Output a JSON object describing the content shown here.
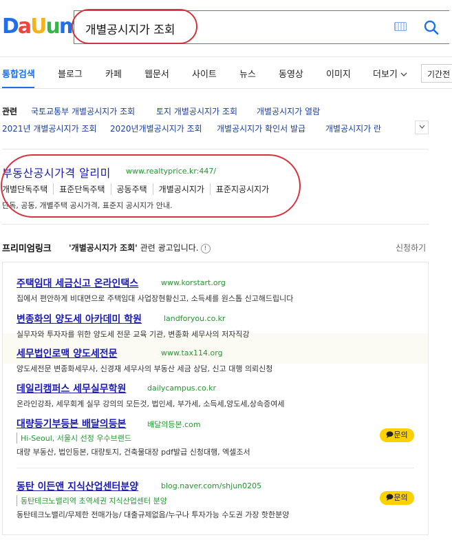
{
  "logo": {
    "letters": [
      "D",
      "a",
      "U",
      "u",
      "m"
    ]
  },
  "search": {
    "query": "개별공시지가 조회"
  },
  "tabs": [
    "통합검색",
    "블로그",
    "카페",
    "웹문서",
    "사이트",
    "뉴스",
    "동영상",
    "이미지",
    "더보기"
  ],
  "period_label": "기간전",
  "related": {
    "heading": "관련",
    "row1": [
      "국토교통부 개별공시지가 조회",
      "토지 개별공시지가 조회",
      "개별공시지가 열람"
    ],
    "row2": [
      "2021년 개별공시지가 조회",
      "2020년개별공시지가 조회",
      "개별공시지가 확인서 발급",
      "개별공시지가 란"
    ]
  },
  "site": {
    "title": "부동산공시가격 알리미",
    "url": "www.realtyprice.kr:447/",
    "links": [
      "개별단독주택",
      "표준단독주택",
      "공동주택",
      "개별공시지가",
      "표준지공시지가"
    ],
    "desc": "단독, 공동, 개별주택 공시가격, 표준지 공시지가 안내."
  },
  "premium": {
    "heading": "프리미엄링크",
    "query": "'개별공시지가 조회'",
    "suffix": "관련 광고입니다.",
    "info_icon": "!",
    "apply": "신청하기"
  },
  "ads": [
    {
      "title": "주택임대 세금신고 온라인택스",
      "url": "www.korstart.org",
      "desc": "집에서 편안하게 비대면으로 주택임대 사업장현황신고, 소득세를 원스톱 신고해드립니다"
    },
    {
      "title": "변종화의 양도세 아카데미 학원",
      "url": "landforyou.co.kr",
      "desc": "실무자와 투자자를 위한 양도세 전문 교육 기관, 변종화 세무사의 저자직강"
    },
    {
      "title": "세무법인로맥 양도세전문",
      "url": "www.tax114.org",
      "desc": "양도세전문 변종화세무사, 신경재 세무사의 부동산 세금 상담, 신고 대행 의뢰신청"
    },
    {
      "title": "데일리캠퍼스 세무실무학원",
      "url": "dailycampus.co.kr",
      "desc": "온라인강좌, 세무회계 실무 강의의 모든것, 법인세, 부가세, 소득세,양도세,상속증여세"
    },
    {
      "title": "대량등기부등본 배달의등본",
      "url": "배달의등본.com",
      "sub": "Hi-Seoul, 서울시 선정 우수브랜드",
      "desc": "대량 부동산, 법인등본, 대량토지, 건축물대장 pdf발급 신청대행, 엑셀조서",
      "inquiry": "문의"
    },
    {
      "title": "동탄 이든앤 지식산업센터분양",
      "url": "blog.naver.com/shjun0205",
      "sub": "동탄테크노밸리역 초역세권 지식산업센터 분양",
      "desc": "동탄테크노밸리/무제한 전매가능/ 대출규제없음/누구나 투자가능 수도권 가장 핫한분양",
      "inquiry": "문의"
    }
  ]
}
